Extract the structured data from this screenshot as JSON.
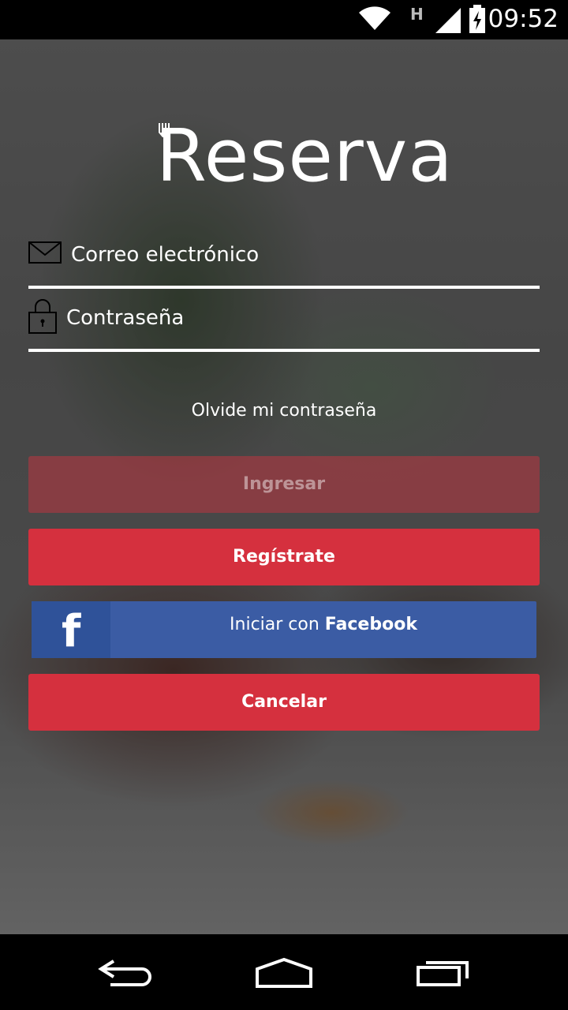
{
  "status_bar": {
    "time": "09:52",
    "network_type": "H",
    "icons": [
      "wifi-icon",
      "signal-icon",
      "battery-charging-icon"
    ]
  },
  "logo": {
    "text": "Reserva",
    "icon": "fork-icon"
  },
  "form": {
    "email": {
      "placeholder": "Correo electrónico",
      "value": "",
      "icon": "envelope-icon"
    },
    "password": {
      "placeholder": "Contraseña",
      "value": "",
      "icon": "lock-icon"
    },
    "forgot_label": "Olvide mi contraseña"
  },
  "buttons": {
    "login": "Ingresar",
    "register": "Regístrate",
    "facebook_prefix": "Iniciar con ",
    "facebook_brand": "Facebook",
    "cancel": "Cancelar"
  },
  "nav_bar": {
    "icons": [
      "back-icon",
      "home-icon",
      "recent-apps-icon"
    ]
  },
  "colors": {
    "accent_red": "#d5303e",
    "facebook_blue": "#3b5ca4"
  }
}
